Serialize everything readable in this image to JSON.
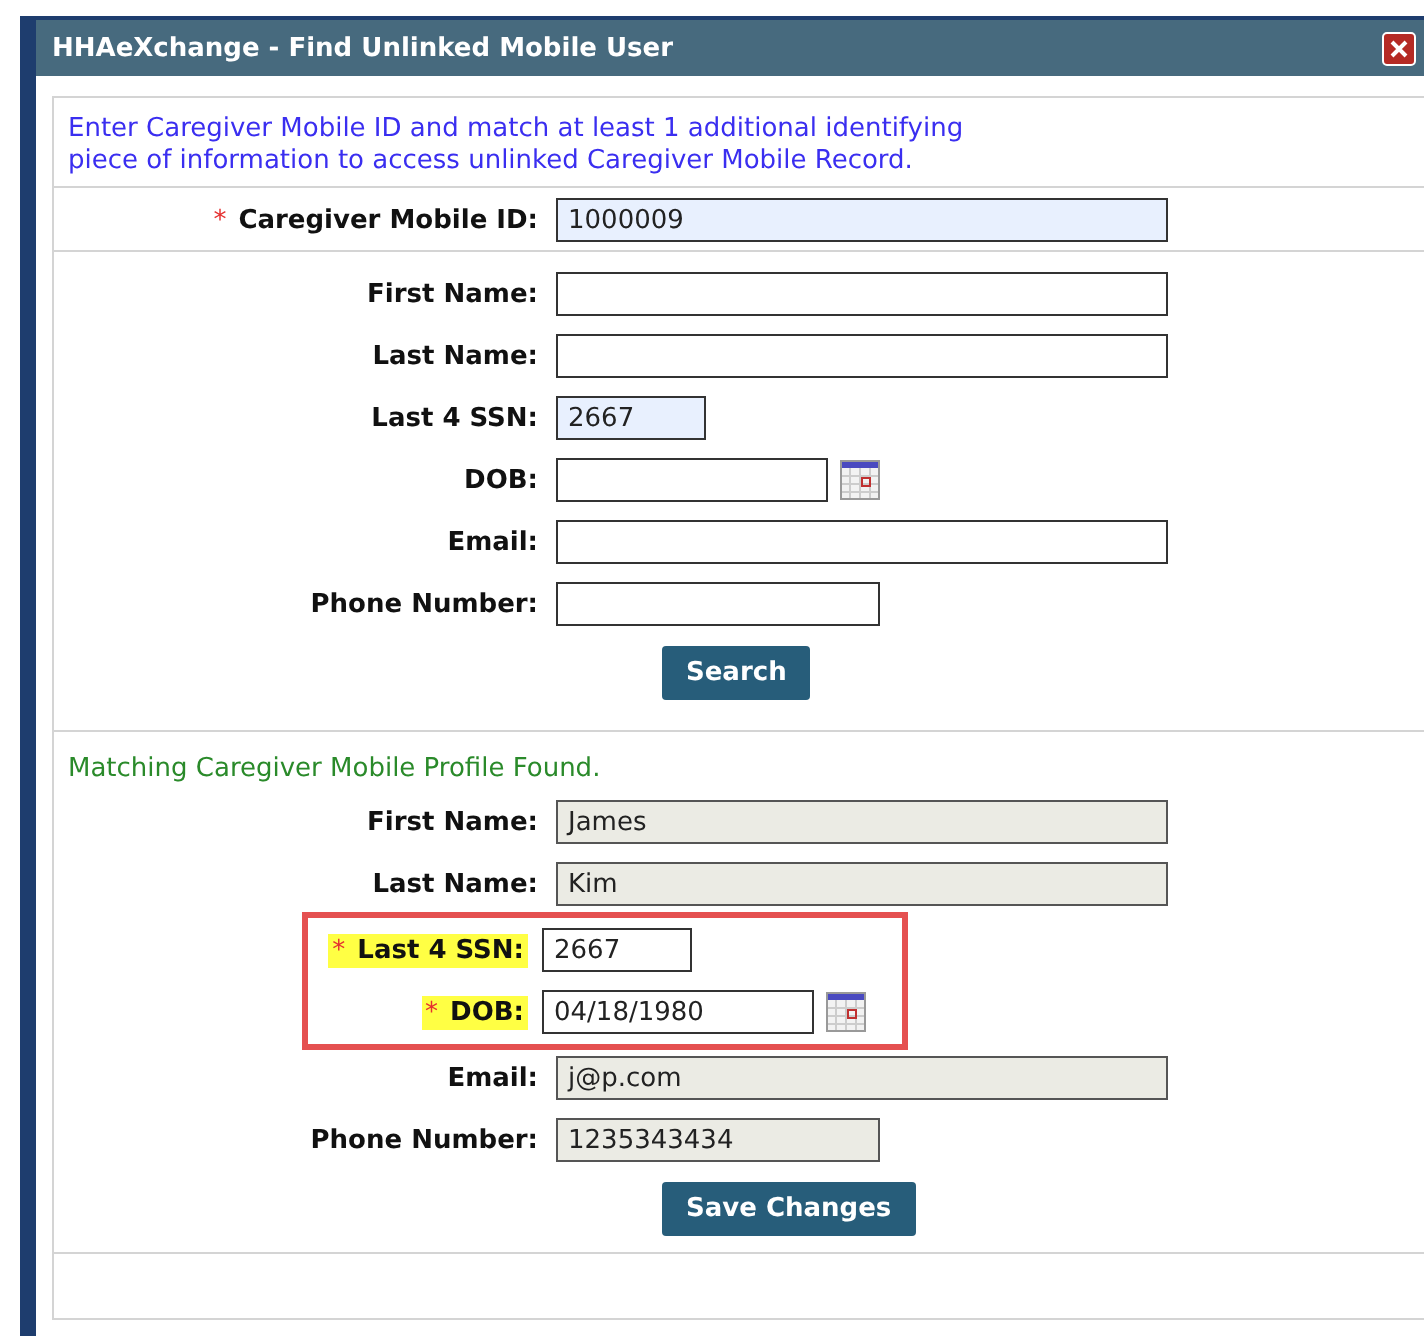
{
  "window": {
    "title": "HHAeXchange - Find Unlinked Mobile User"
  },
  "instructions": "Enter Caregiver Mobile ID and match at least 1 additional identifying piece of information to access unlinked Caregiver Mobile Record.",
  "sections": [
    {
      "fields": [
        {
          "label": "Caregiver Mobile ID:",
          "value": "1000009",
          "kind": "wide",
          "required_mark": "*",
          "prefilled": true,
          "readonly": false,
          "highlighted": false
        }
      ]
    },
    {
      "fields": [
        {
          "label": "First Name:",
          "kind": "wide",
          "prefilled": false,
          "readonly": false,
          "highlighted": false
        },
        {
          "label": "Last Name:",
          "kind": "wide",
          "prefilled": false,
          "readonly": false,
          "highlighted": false
        },
        {
          "label": "Last 4 SSN:",
          "value": "2667",
          "kind": "short",
          "prefilled": true,
          "readonly": false,
          "highlighted": false
        },
        {
          "label": "DOB:",
          "kind": "date",
          "prefilled": false,
          "readonly": false,
          "highlighted": false
        },
        {
          "label": "Email:",
          "kind": "wide",
          "prefilled": false,
          "readonly": false,
          "highlighted": false
        },
        {
          "label": "Phone Number:",
          "kind": "medium",
          "prefilled": false,
          "readonly": false,
          "highlighted": false
        }
      ],
      "button": "Search"
    },
    {
      "message": "Matching Caregiver Mobile Profile Found.",
      "fields": [
        {
          "label": "First Name:",
          "value": "James",
          "kind": "wide",
          "prefilled": false,
          "readonly": true,
          "highlighted": false
        },
        {
          "label": "Last Name:",
          "value": "Kim",
          "kind": "wide",
          "prefilled": false,
          "readonly": true,
          "highlighted": false
        },
        {
          "label": "Last 4 SSN:",
          "value": "2667",
          "kind": "short",
          "required_mark": "*",
          "prefilled": false,
          "readonly": false,
          "highlighted": true
        },
        {
          "label": "DOB:",
          "value": "04/18/1980",
          "kind": "date",
          "required_mark": "*",
          "prefilled": false,
          "readonly": false,
          "highlighted": true
        },
        {
          "label": "Email:",
          "value": "j@p.com",
          "kind": "wide",
          "prefilled": false,
          "readonly": true,
          "highlighted": false
        },
        {
          "label": "Phone Number:",
          "value": "1235343434",
          "kind": "medium",
          "prefilled": false,
          "readonly": true,
          "highlighted": false
        }
      ],
      "button": "Save Changes"
    }
  ]
}
